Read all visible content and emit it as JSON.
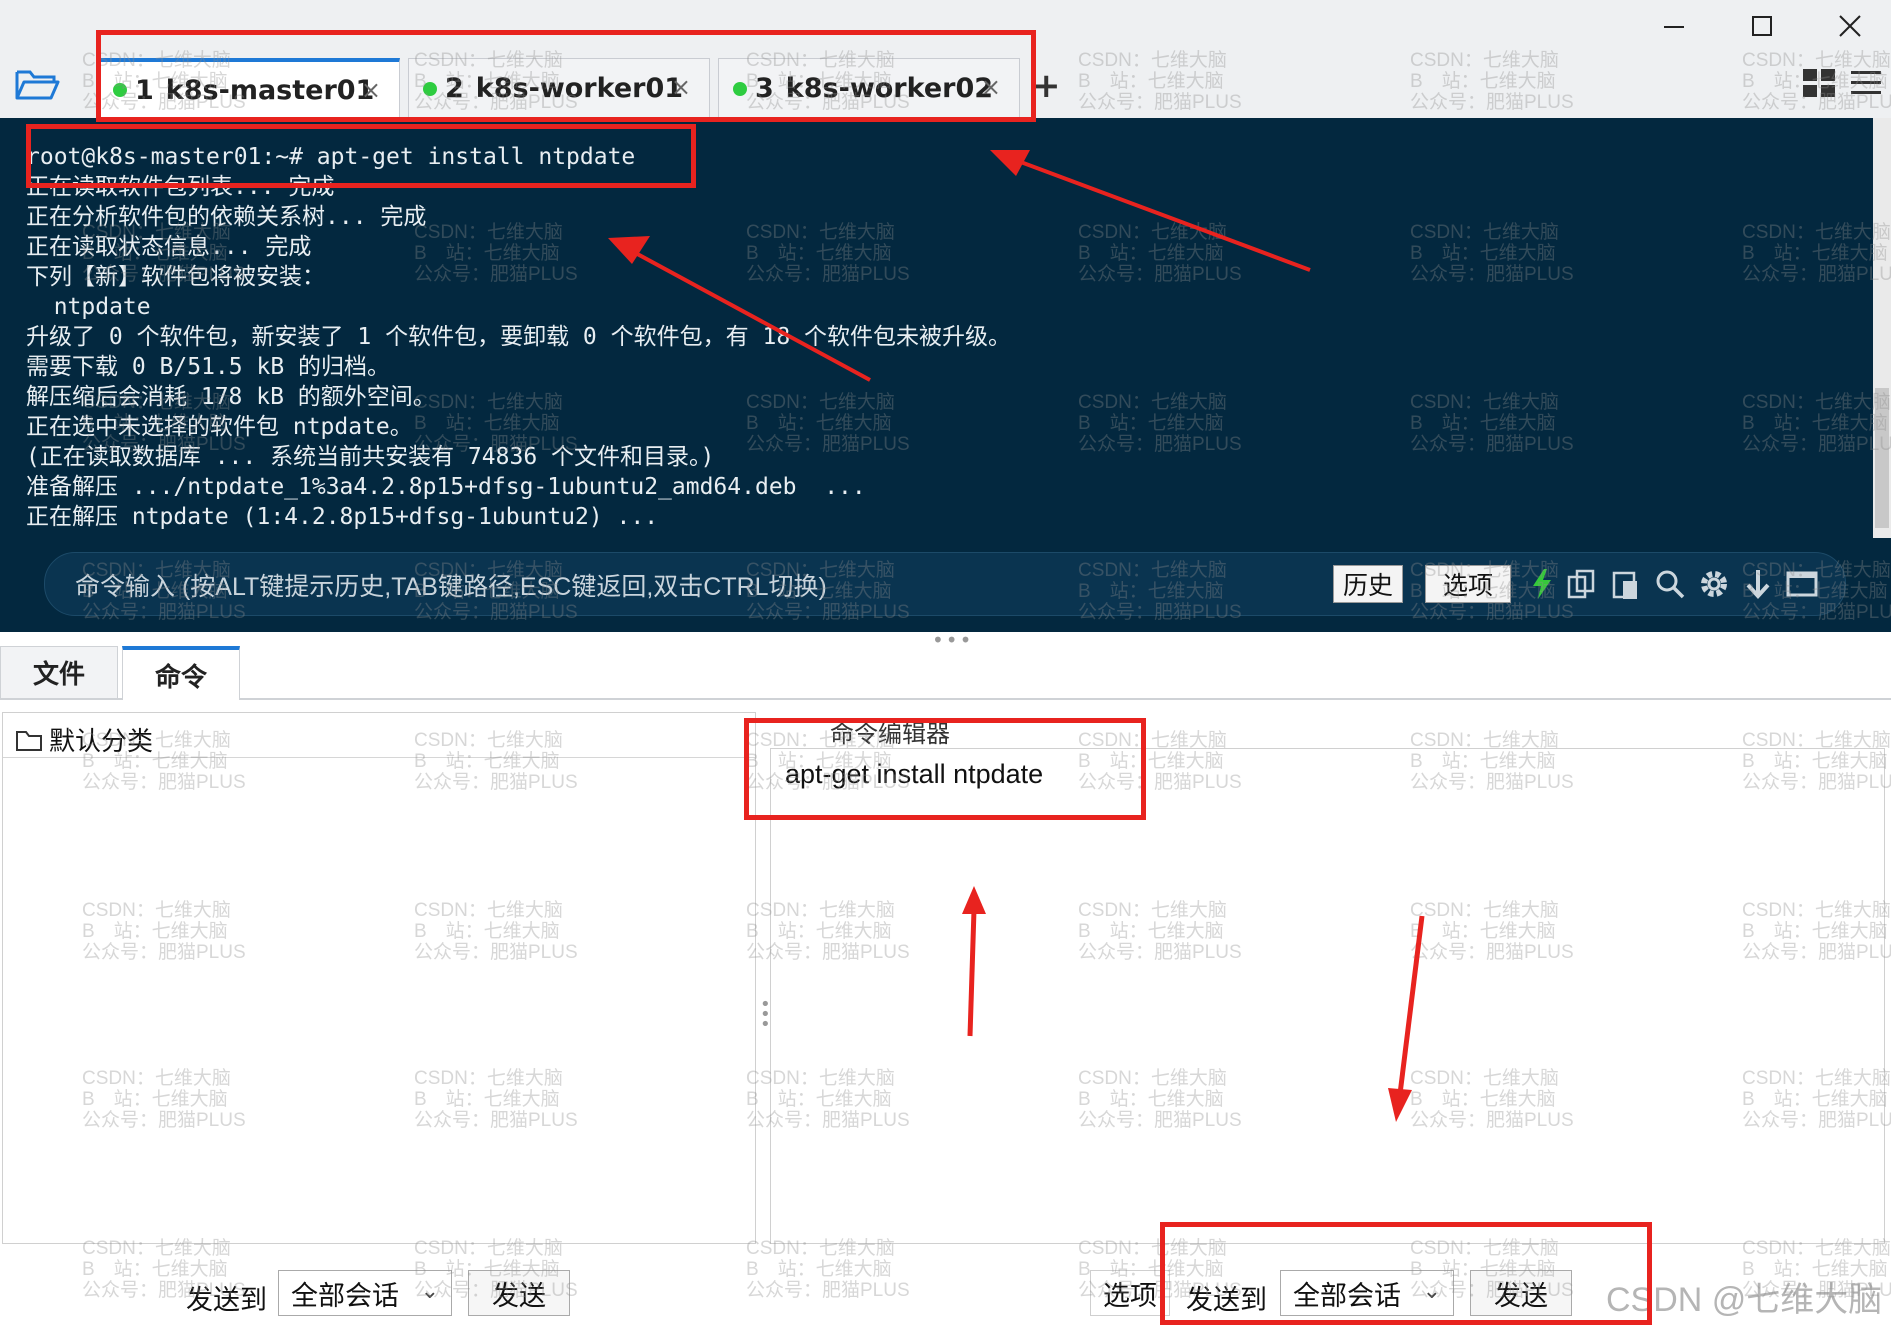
{
  "window": {
    "controls": [
      "minimize-icon",
      "maximize-icon",
      "close-icon"
    ]
  },
  "tabs": [
    {
      "num": "1",
      "label": "k8s-master01",
      "status_color": "#2ecc40",
      "active": true
    },
    {
      "num": "2",
      "label": "k8s-worker01",
      "status_color": "#2ecc40",
      "active": false
    },
    {
      "num": "3",
      "label": "k8s-worker02",
      "status_color": "#2ecc40",
      "active": false
    }
  ],
  "tab_close": "×",
  "tab_add": "+",
  "terminal": {
    "lines": [
      "root@k8s-master01:~# apt-get install ntpdate",
      "正在读取软件包列表... 完成",
      "正在分析软件包的依赖关系树... 完成",
      "正在读取状态信息... 完成",
      "下列【新】软件包将被安装：",
      "  ntpdate",
      "升级了 0 个软件包，新安装了 1 个软件包，要卸载 0 个软件包，有 18 个软件包未被升级。",
      "需要下载 0 B/51.5 kB 的归档。",
      "解压缩后会消耗 178 kB 的额外空间。",
      "正在选中未选择的软件包 ntpdate。",
      "(正在读取数据库 ... 系统当前共安装有 74836 个文件和目录。)",
      "准备解压 .../ntpdate_1%3a4.2.8p15+dfsg-1ubuntu2_amd64.deb  ...",
      "正在解压 ntpdate (1:4.2.8p15+dfsg-1ubuntu2) ..."
    ],
    "background": "#03283f"
  },
  "command_bar": {
    "placeholder": "命令输入 (按ALT键提示历史,TAB键路径,ESC键返回,双击CTRL切换)",
    "history_label": "历史",
    "options_label": "选项"
  },
  "bottom_tabs": [
    {
      "label": "文件",
      "active": false
    },
    {
      "label": "命令",
      "active": true
    }
  ],
  "left_pane": {
    "category": "默认分类",
    "send_to_label": "发送到",
    "target": "全部会话",
    "send_label": "发送"
  },
  "editor": {
    "title": "命令编辑器",
    "content": "apt-get install ntpdate",
    "options_label": "选项",
    "send_to_label": "发送到",
    "target": "全部会话",
    "send_label": "发送"
  },
  "watermark": {
    "line1": "CSDN：七维大脑",
    "line2": "B　站：七维大脑",
    "line3": "公众号：肥猫PLUS"
  },
  "footer_watermark": "CSDN @七维大脑",
  "annotation_color": "#e8231f"
}
